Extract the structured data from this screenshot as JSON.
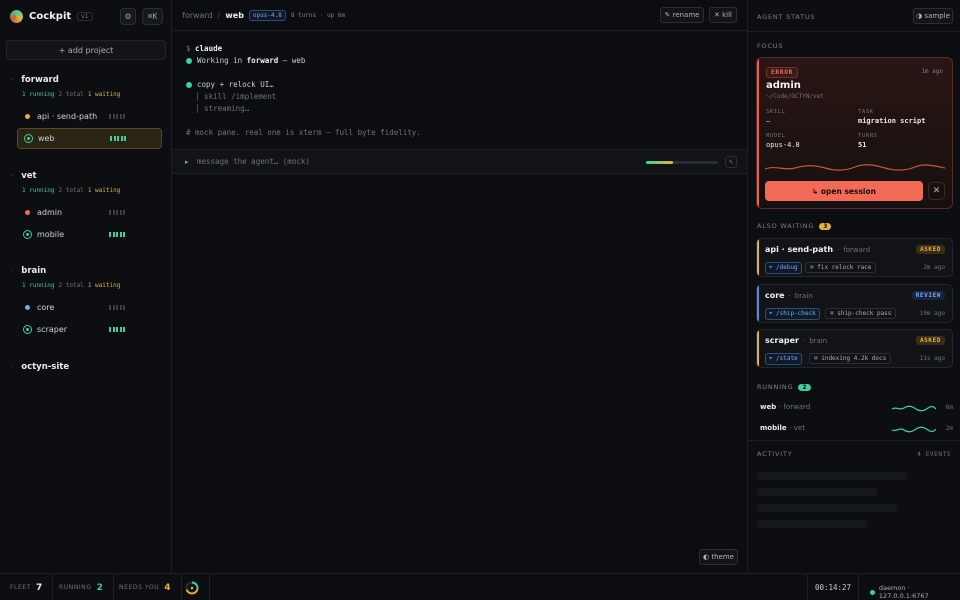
{
  "colors": {
    "running": "#3ecf9a",
    "waiting": "#e8b13a",
    "error": "#f06a56",
    "review": "#5a8ae0",
    "info": "#6fa8f0"
  },
  "sidebar": {
    "brand": "Cockpit",
    "version": "v1",
    "settings_icon": "gear-icon",
    "shortcut_label": "⌘K",
    "add_project_label": "+ add project",
    "projects": [
      {
        "name": "forward",
        "running": "1 running",
        "total": "2 total",
        "waiting": "1 waiting",
        "sessions": [
          {
            "name": "api · send-path",
            "status": "waiting"
          },
          {
            "name": "web",
            "status": "running",
            "active": true
          }
        ]
      },
      {
        "name": "vet",
        "running": "1 running",
        "total": "2 total",
        "waiting": "1 waiting",
        "sessions": [
          {
            "name": "admin",
            "status": "error"
          },
          {
            "name": "mobile",
            "status": "running"
          }
        ]
      },
      {
        "name": "brain",
        "running": "1 running",
        "total": "2 total",
        "waiting": "1 waiting",
        "sessions": [
          {
            "name": "core",
            "status": "review"
          },
          {
            "name": "scraper",
            "status": "running"
          }
        ]
      },
      {
        "name": "octyn-site",
        "sessions": []
      }
    ]
  },
  "main": {
    "breadcrumb_project": "forward",
    "breadcrumb_sep": "/",
    "breadcrumb_session": "web",
    "model": "opus-4.8",
    "meta": "8 turns · up 6m",
    "rename_label": "✎ rename",
    "kill_label": "✕ kill",
    "terminal": {
      "cmd_prefix": "$",
      "cmd": "claude",
      "working_prefix": "Working in ",
      "working_project": "forward",
      "working_suffix": " — web",
      "task": "copy + relock UI…",
      "sub1": "│ skill /implement",
      "sub2": "│ streaming…",
      "note": "# mock pane. real one is xterm — full byte fidelity."
    },
    "prompt_placeholder": "message the agent…  (mock)",
    "context_fill": 0.38,
    "theme_label": "◐ theme"
  },
  "right_panel": {
    "title": "AGENT STATUS",
    "sample_label": "◑ sample",
    "focus_label": "FOCUS",
    "focus": {
      "state": "ERROR",
      "time": "1m ago",
      "name": "admin",
      "path": "~/Code/OCTYN/vet",
      "skill_label": "SKILL",
      "skill": "—",
      "task_label": "TASK",
      "task": "migration script",
      "model_label": "MODEL",
      "model": "opus-4.8",
      "turns_label": "TURNS",
      "turns": "51",
      "open_label": "↳ open session"
    },
    "waiting_label": "ALSO WAITING",
    "waiting_count": "3",
    "waiting": [
      {
        "name": "api · send-path",
        "project": "forward",
        "state": "ASKED",
        "kind": "asked",
        "cmd": "⌖ /debug",
        "note": "⌘ fix relock race",
        "time": "2m ago"
      },
      {
        "name": "core",
        "project": "brain",
        "state": "REVIEW",
        "kind": "review",
        "cmd": "⌖ /ship-check",
        "note": "⌘ ship-check pass",
        "time": "10m ago"
      },
      {
        "name": "scraper",
        "project": "brain",
        "state": "ASKED",
        "kind": "asked",
        "cmd": "⌖ /state",
        "note": "⌘ indexing 4.2k docs",
        "time": "11s ago"
      }
    ],
    "running_label": "RUNNING",
    "running_count": "2",
    "running": [
      {
        "name": "web",
        "project": "forward",
        "time": "6m"
      },
      {
        "name": "mobile",
        "project": "vet",
        "time": "2m"
      }
    ],
    "activity_label": "ACTIVITY",
    "activity_count": "4 EVENTS"
  },
  "footer": {
    "fleet_label": "FLEET",
    "fleet": "7",
    "running_label": "RUNNING",
    "running": "2",
    "needs_label": "NEEDS YOU",
    "needs": "4",
    "clock": "00:14:27",
    "daemon": "daemon · 127.0.0.1:6767"
  }
}
